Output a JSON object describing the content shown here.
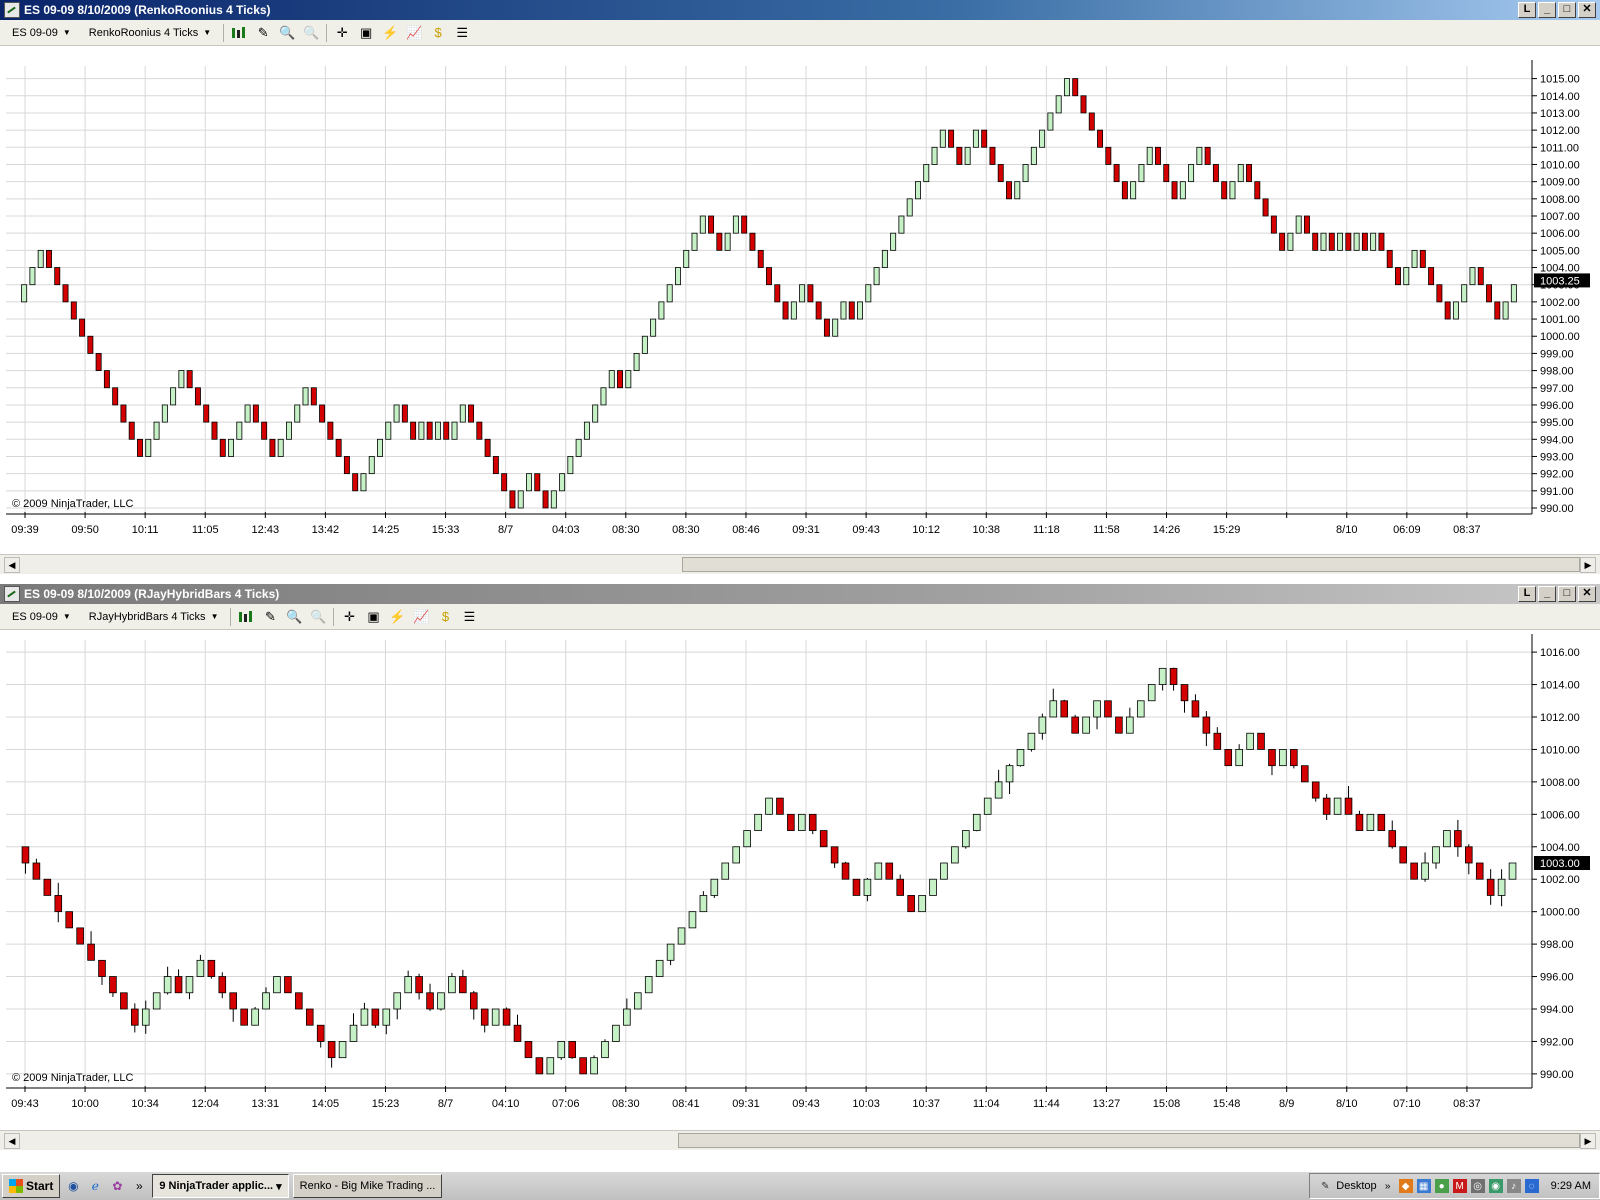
{
  "windows": [
    {
      "title": "ES 09-09  8/10/2009 (RenkoRoonius 4 Ticks)",
      "instrument": "ES 09-09",
      "bar_type": "RenkoRoonius 4 Ticks",
      "copyright": "© 2009 NinjaTrader, LLC",
      "last_price_label": "1003.25",
      "price_labels": [
        "1015.00",
        "1014.00",
        "1013.00",
        "1012.00",
        "1011.00",
        "1010.00",
        "1009.00",
        "1008.00",
        "1007.00",
        "1006.00",
        "1005.00",
        "1004.00",
        "1003.00",
        "1002.00",
        "1001.00",
        "1000.00",
        "999.00",
        "998.00",
        "997.00",
        "996.00",
        "995.00",
        "994.00",
        "993.00",
        "992.00",
        "991.00",
        "990.00"
      ],
      "time_labels": [
        "09:39",
        "09:50",
        "10:11",
        "11:05",
        "12:43",
        "13:42",
        "14:25",
        "15:33",
        "8/7",
        "04:03",
        "08:30",
        "08:30",
        "08:46",
        "09:31",
        "09:43",
        "10:12",
        "10:38",
        "11:18",
        "11:58",
        "14:26",
        "15:29",
        "",
        "8/10",
        "06:09",
        "08:37"
      ]
    },
    {
      "title": "ES 09-09  8/10/2009 (RJayHybridBars 4 Ticks)",
      "instrument": "ES 09-09",
      "bar_type": "RJayHybridBars 4 Ticks",
      "copyright": "© 2009 NinjaTrader, LLC",
      "last_price_label": "1003.00",
      "price_labels": [
        "1016.00",
        "1014.00",
        "1012.00",
        "1010.00",
        "1008.00",
        "1006.00",
        "1004.00",
        "1002.00",
        "1000.00",
        "998.00",
        "996.00",
        "994.00",
        "992.00",
        "990.00"
      ],
      "time_labels": [
        "09:43",
        "10:00",
        "10:34",
        "12:04",
        "13:31",
        "14:05",
        "15:23",
        "8/7",
        "04:10",
        "07:06",
        "08:30",
        "08:41",
        "09:31",
        "09:43",
        "10:03",
        "10:37",
        "11:04",
        "11:44",
        "13:27",
        "15:08",
        "15:48",
        "8/9",
        "8/10",
        "07:10",
        "08:37"
      ]
    }
  ],
  "taskbar": {
    "start": "Start",
    "tasks": [
      "9 NinjaTrader applic...",
      "Renko - Big Mike Trading ..."
    ],
    "desktop_label": "Desktop",
    "clock": "9:29 AM"
  },
  "chart_data": [
    {
      "type": "renko",
      "title": "ES 09-09  8/10/2009 (RenkoRoonius 4 Ticks)",
      "brick_size": 1.0,
      "ylim": [
        990,
        1015.5
      ],
      "start_price": 1003,
      "path": [
        1002,
        1005,
        1002,
        993,
        998,
        993,
        996,
        993,
        997,
        991,
        996,
        994,
        995,
        994,
        995,
        994,
        996,
        990,
        992,
        990,
        998,
        997,
        1007,
        1005,
        1007,
        1004,
        1004,
        1001,
        1003,
        1000,
        1002,
        1001,
        1012,
        1010,
        1012,
        1008,
        1011,
        1012,
        1015,
        1008,
        1011,
        1008,
        1011,
        1008,
        1010,
        1005,
        1007,
        1005,
        1006,
        1005,
        1006,
        1005,
        1006,
        1005,
        1006,
        1003,
        1005,
        1001,
        1004,
        1001,
        1003
      ],
      "x_labels": [
        "09:39",
        "09:50",
        "10:11",
        "11:05",
        "12:43",
        "13:42",
        "14:25",
        "15:33",
        "8/7",
        "04:03",
        "08:30",
        "08:30",
        "08:46",
        "09:31",
        "09:43",
        "10:12",
        "10:38",
        "11:18",
        "11:58",
        "14:26",
        "15:29",
        "",
        "8/10",
        "06:09",
        "08:37"
      ],
      "last_price": 1003.25
    },
    {
      "type": "candlestick",
      "title": "ES 09-09  8/10/2009 (RJayHybridBars 4 Ticks)",
      "ylim": [
        989.5,
        1016.5
      ],
      "close_path": [
        1004,
        1004,
        993,
        996,
        995,
        997,
        993,
        996,
        994,
        991,
        994,
        993,
        996,
        994,
        996,
        993,
        994,
        991,
        990,
        992,
        990,
        995,
        1005,
        1007,
        1005,
        1006,
        1005,
        1004,
        1001,
        1003,
        1000,
        1003,
        1008,
        1011,
        1013,
        1012,
        1011,
        1013,
        1011,
        1012,
        1015,
        1014,
        1011,
        1009,
        1011,
        1009,
        1010,
        1008,
        1007,
        1006,
        1007,
        1005,
        1006,
        1004,
        1002,
        1004,
        1005,
        1002,
        1001,
        1003,
        1003
      ],
      "x_labels": [
        "09:43",
        "10:00",
        "10:34",
        "12:04",
        "13:31",
        "14:05",
        "15:23",
        "8/7",
        "04:10",
        "07:06",
        "08:30",
        "08:41",
        "09:31",
        "09:43",
        "10:03",
        "10:37",
        "11:04",
        "11:44",
        "13:27",
        "15:08",
        "15:48",
        "8/9",
        "8/10",
        "07:10",
        "08:37"
      ],
      "last_price": 1003.0
    }
  ],
  "colors": {
    "up_fill": "#c6f0c6",
    "down_fill": "#d40000",
    "grid": "#d8d8d8",
    "last_price_bg": "#000000"
  }
}
